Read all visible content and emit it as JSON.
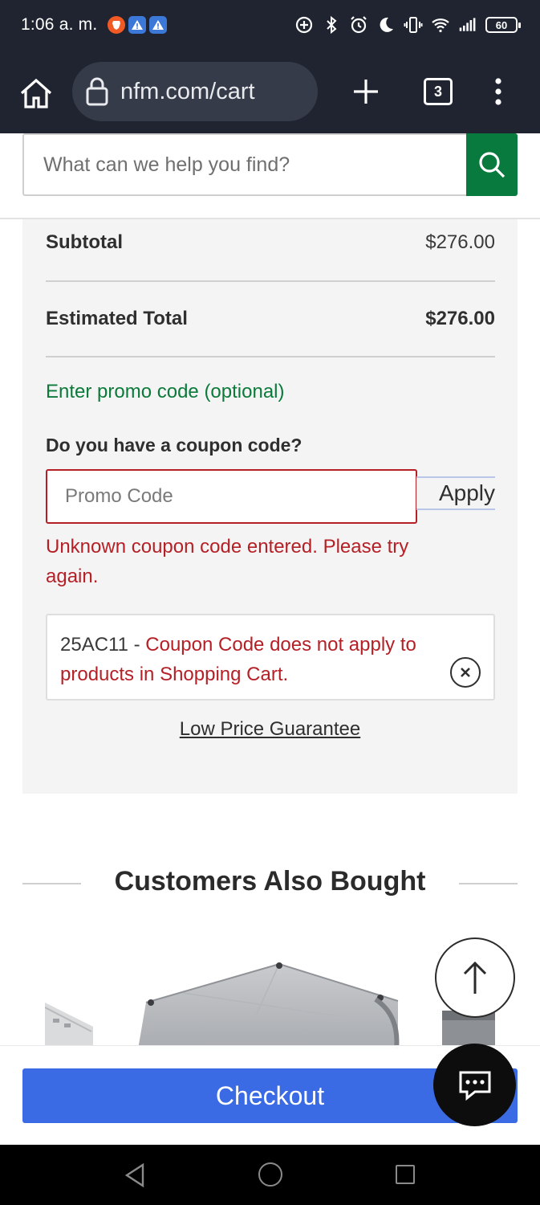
{
  "status_bar": {
    "time": "1:06 a. m.",
    "battery": "60"
  },
  "browser": {
    "url": "nfm.com/cart",
    "tab_count": "3"
  },
  "search": {
    "placeholder": "What can we help you find?"
  },
  "summary": {
    "subtotal_label": "Subtotal",
    "subtotal_value": "$276.00",
    "estimated_total_label": "Estimated Total",
    "estimated_total_value": "$276.00",
    "promo_link": "Enter promo code (optional)",
    "coupon_question": "Do you have a coupon code?",
    "promo_placeholder": "Promo Code",
    "apply_label": "Apply",
    "error_message": "Unknown coupon code entered. Please try again.",
    "notice_code": "25AC11",
    "notice_separator": " - ",
    "notice_message": "Coupon Code does not apply to products in Shopping Cart.",
    "low_price_guarantee": "Low Price Guarantee"
  },
  "customers_also_bought": {
    "title": "Customers Also Bought"
  },
  "checkout": {
    "label": "Checkout"
  },
  "colors": {
    "brand_green": "#087a3d",
    "error_red": "#b52026",
    "checkout_blue": "#3a6be5"
  }
}
